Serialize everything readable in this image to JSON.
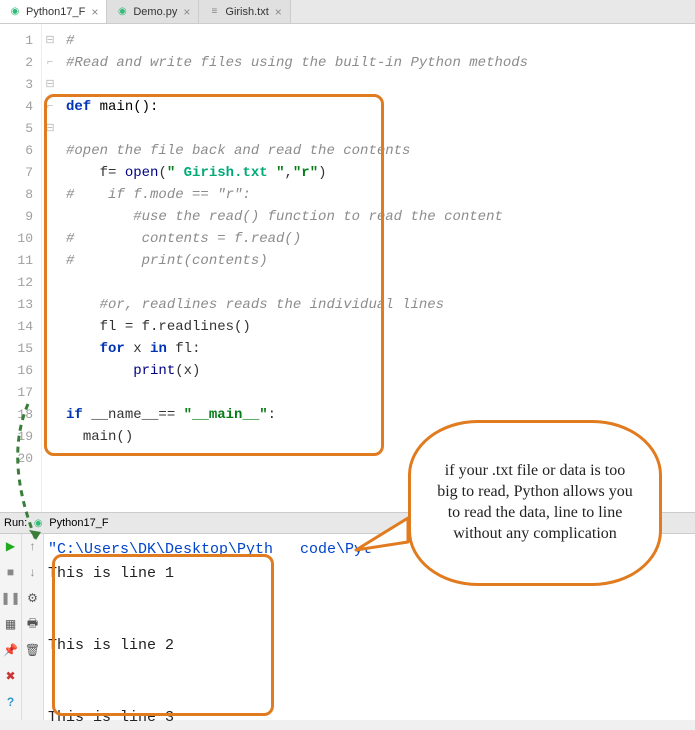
{
  "tabs": [
    {
      "label": "Python17_F",
      "icon": "python-icon",
      "active": true
    },
    {
      "label": "Demo.py",
      "icon": "python-icon",
      "active": false
    },
    {
      "label": "Girish.txt",
      "icon": "text-icon",
      "active": false
    }
  ],
  "code": {
    "lines": [
      {
        "n": 1,
        "html": "<span class='cm'>#</span>"
      },
      {
        "n": 2,
        "html": "<span class='cm'>#Read and write files using the built-in Python methods</span>"
      },
      {
        "n": 3,
        "html": ""
      },
      {
        "n": 4,
        "html": "<span class='kw'>def</span> <span class='fn'>main():</span>"
      },
      {
        "n": 5,
        "html": ""
      },
      {
        "n": 6,
        "html": "<span class='cm'>#open the file back and read the contents</span>"
      },
      {
        "n": 7,
        "html": "    <span class='plain'>f= </span><span class='builtin'>open</span><span class='plain'>(</span><span class='str'>\" </span><span class='hl'>Girish.txt</span><span class='str'> \"</span><span class='plain'>,</span><span class='str'>\"r\"</span><span class='plain'>)</span>"
      },
      {
        "n": 8,
        "html": "<span class='cm'>#    if f.mode == \"r\":</span>"
      },
      {
        "n": 9,
        "html": "        <span class='cm'>#use the read() function to read the content</span>"
      },
      {
        "n": 10,
        "html": "<span class='cm'>#        contents = f.read()</span>"
      },
      {
        "n": 11,
        "html": "<span class='cm'>#        print(contents)</span>"
      },
      {
        "n": 12,
        "html": ""
      },
      {
        "n": 13,
        "html": "    <span class='cm'>#or, readlines reads the individual lines</span>"
      },
      {
        "n": 14,
        "html": "    <span class='plain'>fl = f.readlines()</span>"
      },
      {
        "n": 15,
        "html": "    <span class='kw'>for</span> <span class='plain'>x </span><span class='kw'>in</span> <span class='plain'>fl:</span>"
      },
      {
        "n": 16,
        "html": "        <span class='builtin'>print</span><span class='plain'>(x)</span>"
      },
      {
        "n": 17,
        "html": ""
      },
      {
        "n": 18,
        "html": "<span class='kw'>if</span> <span class='plain'>__name__== </span><span class='str'>\"__main__\"</span><span class='plain'>:</span>"
      },
      {
        "n": 19,
        "html": "  <span class='plain'>main()</span>"
      },
      {
        "n": 20,
        "html": ""
      }
    ]
  },
  "run_label": "Run:",
  "run_config": "Python17_F",
  "console": {
    "path": "\"C:\\Users\\DK\\Desktop\\Pyth   code\\Pyt",
    "lines": [
      "This is line 1",
      "",
      "",
      "This is line 2",
      "",
      "",
      "This is line 3"
    ]
  },
  "callout_text": "if your .txt file or data is too big to read, Python allows you to read the data, line to line without any complication",
  "icons": {
    "run": "▶",
    "stop": "■",
    "pause": "❚❚",
    "rerun": "↻",
    "down": "↓",
    "up": "↑",
    "settings": "⚙",
    "layout": "▦",
    "pin": "📌",
    "trash": "🗑",
    "close_red": "✖",
    "help": "?",
    "print": "🖶"
  }
}
